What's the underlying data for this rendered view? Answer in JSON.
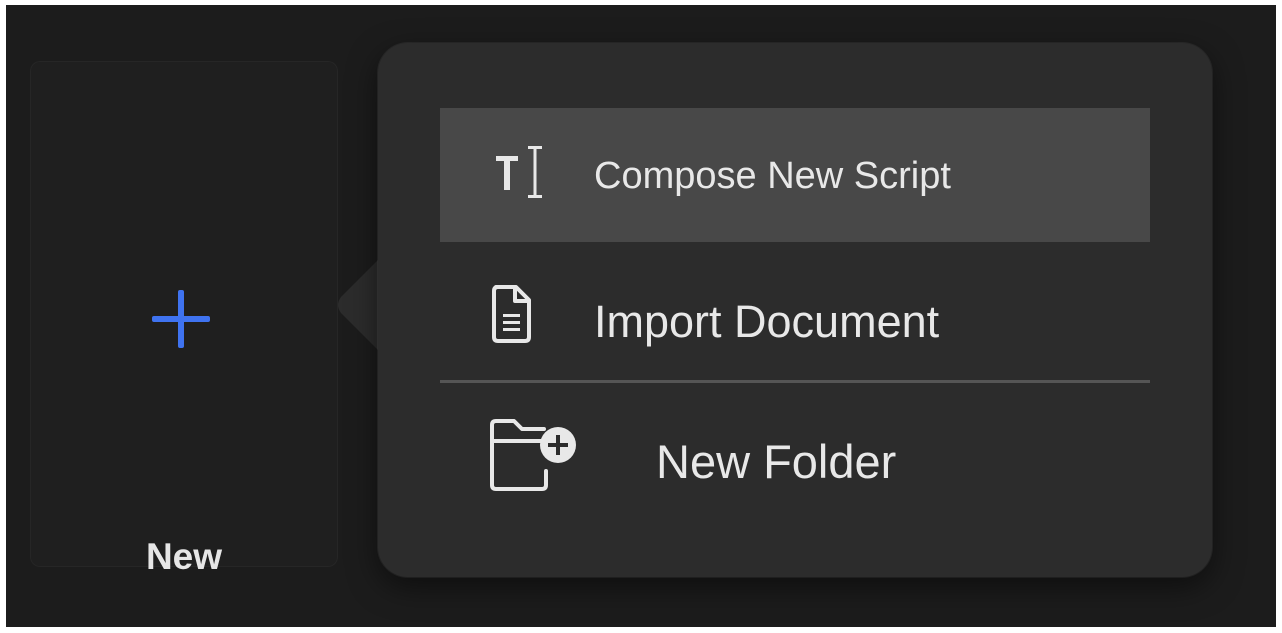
{
  "new_tile": {
    "label": "New",
    "icon": "plus-icon",
    "icon_color": "#3f73f0"
  },
  "menu": {
    "items": [
      {
        "label": "Compose New Script",
        "icon": "text-cursor-icon",
        "highlighted": true
      },
      {
        "label": "Import Document",
        "icon": "document-icon",
        "highlighted": false
      },
      {
        "label": "New Folder",
        "icon": "folder-add-icon",
        "highlighted": false
      }
    ],
    "highlight_color": "#484848",
    "background_color": "#2c2c2c"
  }
}
